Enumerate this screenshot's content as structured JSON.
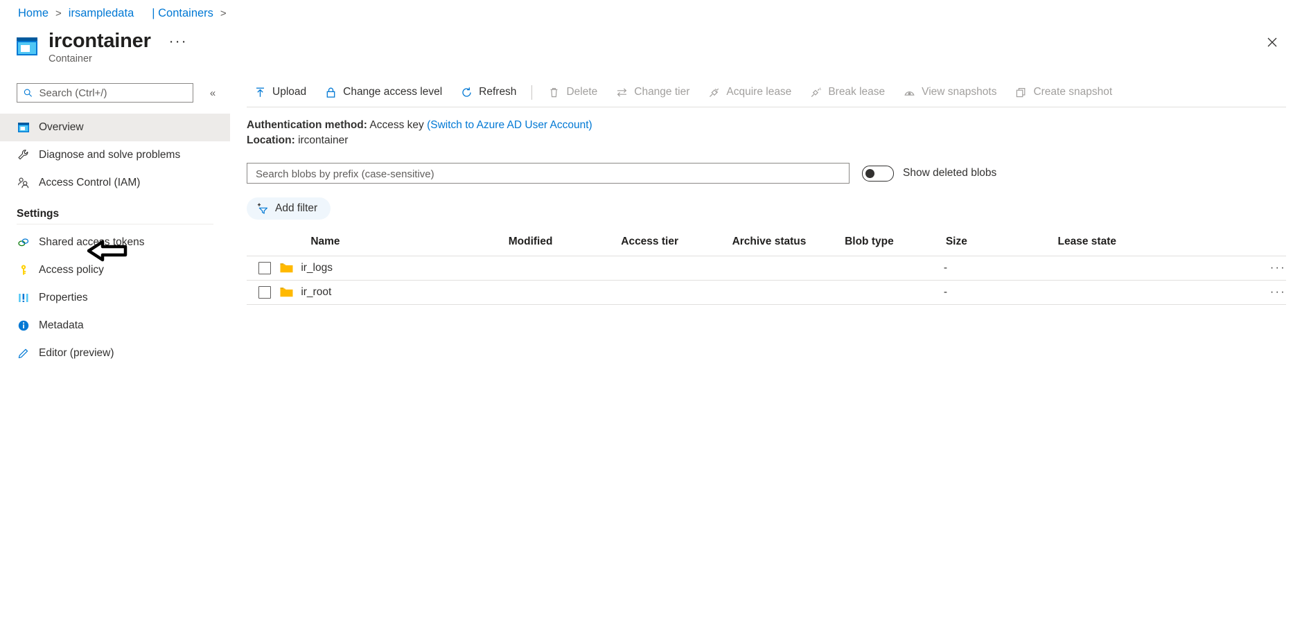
{
  "breadcrumb": {
    "items": [
      {
        "label": "Home",
        "type": "link"
      },
      {
        "label": "irsampledata",
        "type": "link"
      },
      {
        "label": "| Containers",
        "type": "link"
      }
    ],
    "separator": ">"
  },
  "header": {
    "title": "ircontainer",
    "subtitle": "Container",
    "ellipsis": "···",
    "close_label": "✕",
    "icon": "container-icon"
  },
  "sidebar": {
    "search": {
      "placeholder": "Search (Ctrl+/)",
      "value": "",
      "icon": "search-icon"
    },
    "collapse_icon": "«",
    "items": [
      {
        "label": "Overview",
        "icon": "overview-icon",
        "selected": true
      },
      {
        "label": "Diagnose and solve problems",
        "icon": "wrench-icon",
        "selected": false
      },
      {
        "label": "Access Control (IAM)",
        "icon": "people-icon",
        "selected": false
      }
    ],
    "group_title": "Settings",
    "settings_items": [
      {
        "label": "Shared access tokens",
        "icon": "link-rings-icon",
        "selected": false
      },
      {
        "label": "Access policy",
        "icon": "key-icon",
        "selected": false
      },
      {
        "label": "Properties",
        "icon": "properties-icon",
        "selected": false
      },
      {
        "label": "Metadata",
        "icon": "info-icon",
        "selected": false
      },
      {
        "label": "Editor (preview)",
        "icon": "pencil-icon",
        "selected": false
      }
    ]
  },
  "annotation": {
    "type": "left-arrow",
    "target": "Properties",
    "color": "#000000"
  },
  "toolbar": {
    "commands": [
      {
        "label": "Upload",
        "icon": "upload-icon",
        "disabled": false
      },
      {
        "label": "Change access level",
        "icon": "lock-icon",
        "disabled": false
      },
      {
        "label": "Refresh",
        "icon": "refresh-icon",
        "disabled": false
      },
      {
        "label": "Delete",
        "icon": "trash-icon",
        "disabled": true
      },
      {
        "label": "Change tier",
        "icon": "swap-icon",
        "disabled": true
      },
      {
        "label": "Acquire lease",
        "icon": "plug-icon",
        "disabled": true
      },
      {
        "label": "Break lease",
        "icon": "plug-break-icon",
        "disabled": true
      },
      {
        "label": "View snapshots",
        "icon": "snapshot-view-icon",
        "disabled": true
      },
      {
        "label": "Create snapshot",
        "icon": "snapshot-create-icon",
        "disabled": true
      }
    ]
  },
  "info": {
    "auth_label": "Authentication method:",
    "auth_value": "Access key",
    "auth_link": "(Switch to Azure AD User Account)",
    "location_label": "Location:",
    "location_value": "ircontainer"
  },
  "filters": {
    "blob_search_placeholder": "Search blobs by prefix (case-sensitive)",
    "blob_search_value": "",
    "toggle_label": "Show deleted blobs",
    "toggle_on": false,
    "add_filter_label": "Add filter",
    "add_filter_icon": "add-filter-icon"
  },
  "table": {
    "columns": [
      "Name",
      "Modified",
      "Access tier",
      "Archive status",
      "Blob type",
      "Size",
      "Lease state"
    ],
    "rows": [
      {
        "name": "ir_logs",
        "icon": "folder-icon",
        "modified": "",
        "access_tier": "",
        "archive_status": "",
        "blob_type": "",
        "size": "-",
        "lease_state": "",
        "menu": "···",
        "checked": false
      },
      {
        "name": "ir_root",
        "icon": "folder-icon",
        "modified": "",
        "access_tier": "",
        "archive_status": "",
        "blob_type": "",
        "size": "-",
        "lease_state": "",
        "menu": "···",
        "checked": false
      }
    ]
  },
  "colors": {
    "accent": "#0078d4",
    "folder": "#ffb900",
    "selected_bg": "#edebe9",
    "disabled_text": "#a19f9d",
    "chip_bg": "#eff6fc"
  }
}
